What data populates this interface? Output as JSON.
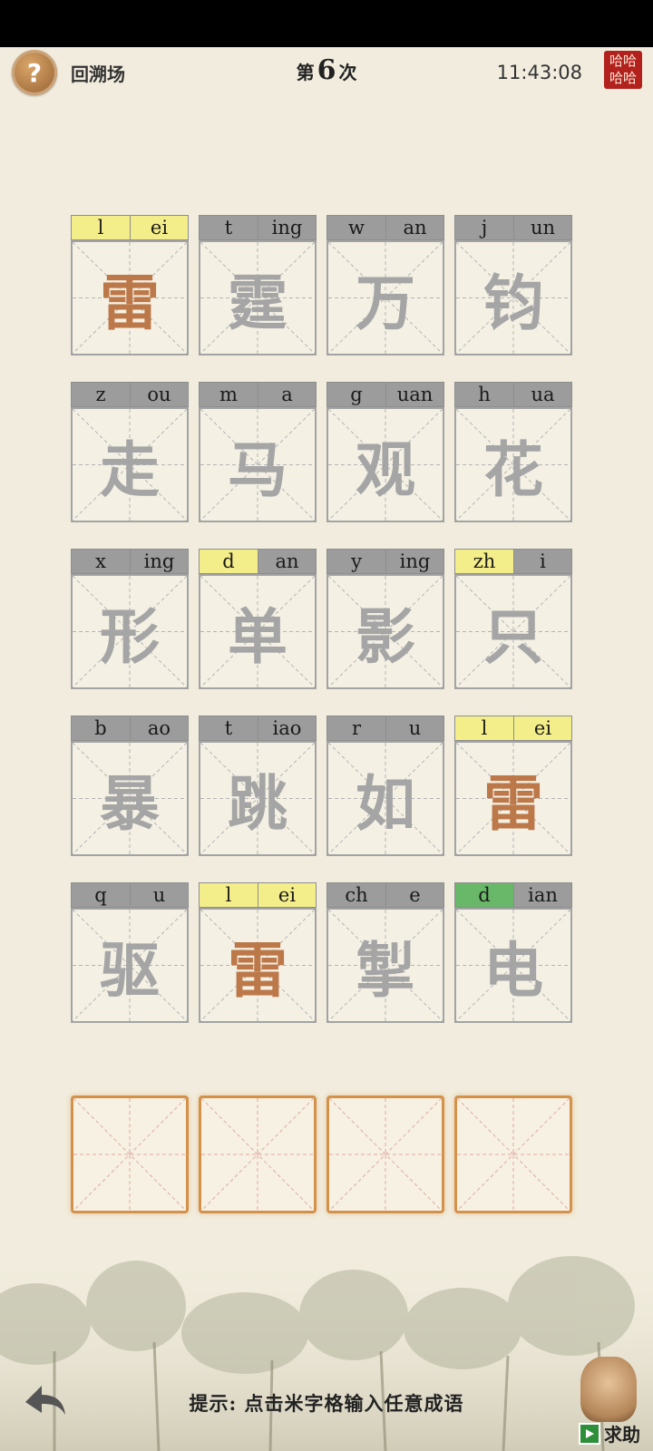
{
  "header": {
    "help_icon": "?",
    "back_label": "回溯场",
    "round_prefix": "第",
    "round_number": "6",
    "round_suffix": "次",
    "time": "11:43:08",
    "seal_text": "哈哈哈哈"
  },
  "colors": {
    "gray": "#9c9c9c",
    "yellow": "#f4ee8a",
    "green": "#69b86a",
    "highlight": "#bc7848",
    "dim": "#a5a5a5"
  },
  "rows": [
    {
      "cards": [
        {
          "ini": "l",
          "fin": "ei",
          "char": "雷",
          "ini_state": "yellow",
          "fin_state": "yellow",
          "hl": true
        },
        {
          "ini": "t",
          "fin": "ing",
          "char": "霆",
          "ini_state": "gray",
          "fin_state": "gray",
          "hl": false
        },
        {
          "ini": "w",
          "fin": "an",
          "char": "万",
          "ini_state": "gray",
          "fin_state": "gray",
          "hl": false
        },
        {
          "ini": "j",
          "fin": "un",
          "char": "钧",
          "ini_state": "gray",
          "fin_state": "gray",
          "hl": false
        }
      ]
    },
    {
      "cards": [
        {
          "ini": "z",
          "fin": "ou",
          "char": "走",
          "ini_state": "gray",
          "fin_state": "gray",
          "hl": false
        },
        {
          "ini": "m",
          "fin": "a",
          "char": "马",
          "ini_state": "gray",
          "fin_state": "gray",
          "hl": false
        },
        {
          "ini": "g",
          "fin": "uan",
          "char": "观",
          "ini_state": "gray",
          "fin_state": "gray",
          "hl": false
        },
        {
          "ini": "h",
          "fin": "ua",
          "char": "花",
          "ini_state": "gray",
          "fin_state": "gray",
          "hl": false
        }
      ]
    },
    {
      "cards": [
        {
          "ini": "x",
          "fin": "ing",
          "char": "形",
          "ini_state": "gray",
          "fin_state": "gray",
          "hl": false
        },
        {
          "ini": "d",
          "fin": "an",
          "char": "单",
          "ini_state": "yellow",
          "fin_state": "gray",
          "hl": false
        },
        {
          "ini": "y",
          "fin": "ing",
          "char": "影",
          "ini_state": "gray",
          "fin_state": "gray",
          "hl": false
        },
        {
          "ini": "zh",
          "fin": "i",
          "char": "只",
          "ini_state": "yellow",
          "fin_state": "gray",
          "hl": false
        }
      ]
    },
    {
      "cards": [
        {
          "ini": "b",
          "fin": "ao",
          "char": "暴",
          "ini_state": "gray",
          "fin_state": "gray",
          "hl": false
        },
        {
          "ini": "t",
          "fin": "iao",
          "char": "跳",
          "ini_state": "gray",
          "fin_state": "gray",
          "hl": false
        },
        {
          "ini": "r",
          "fin": "u",
          "char": "如",
          "ini_state": "gray",
          "fin_state": "gray",
          "hl": false
        },
        {
          "ini": "l",
          "fin": "ei",
          "char": "雷",
          "ini_state": "yellow",
          "fin_state": "yellow",
          "hl": true
        }
      ]
    },
    {
      "cards": [
        {
          "ini": "q",
          "fin": "u",
          "char": "驱",
          "ini_state": "gray",
          "fin_state": "gray",
          "hl": false
        },
        {
          "ini": "l",
          "fin": "ei",
          "char": "雷",
          "ini_state": "yellow",
          "fin_state": "yellow",
          "hl": true
        },
        {
          "ini": "ch",
          "fin": "e",
          "char": "掣",
          "ini_state": "gray",
          "fin_state": "gray",
          "hl": false
        },
        {
          "ini": "d",
          "fin": "ian",
          "char": "电",
          "ini_state": "green",
          "fin_state": "gray",
          "hl": false
        }
      ]
    }
  ],
  "answer_slots": [
    "",
    "",
    "",
    ""
  ],
  "footer": {
    "hint": "提示: 点击米字格输入任意成语",
    "back_icon": "back-arrow-icon",
    "helper_label": "求助"
  }
}
